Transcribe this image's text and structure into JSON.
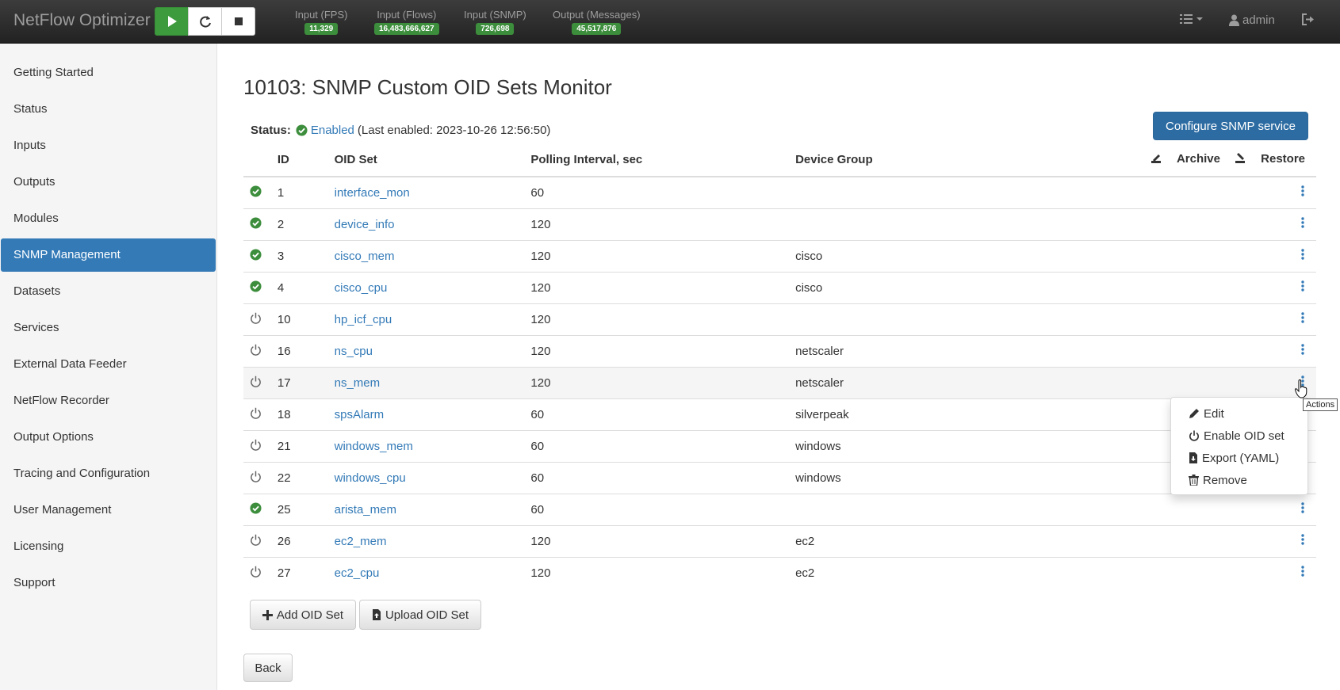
{
  "navbar": {
    "brand": "NetFlow Optimizer",
    "controls": {
      "play": "play-icon",
      "reload": "refresh-icon",
      "stop": "stop-icon"
    },
    "metrics": [
      {
        "label": "Input (FPS)",
        "value": "11,329"
      },
      {
        "label": "Input (Flows)",
        "value": "16,483,666,627"
      },
      {
        "label": "Input (SNMP)",
        "value": "726,698"
      },
      {
        "label": "Output (Messages)",
        "value": "45,517,876"
      }
    ],
    "user": "admin"
  },
  "sidebar": {
    "items": [
      {
        "label": "Getting Started"
      },
      {
        "label": "Status"
      },
      {
        "label": "Inputs"
      },
      {
        "label": "Outputs"
      },
      {
        "label": "Modules"
      },
      {
        "label": "SNMP Management",
        "active": true
      },
      {
        "label": "Datasets"
      },
      {
        "label": "Services"
      },
      {
        "label": "External Data Feeder"
      },
      {
        "label": "NetFlow Recorder"
      },
      {
        "label": "Output Options"
      },
      {
        "label": "Tracing and Configuration"
      },
      {
        "label": "User Management"
      },
      {
        "label": "Licensing"
      },
      {
        "label": "Support"
      }
    ]
  },
  "main": {
    "title": "10103: SNMP Custom OID Sets Monitor",
    "status": {
      "label": "Status:",
      "value": "Enabled",
      "detail": "(Last enabled: 2023-10-26 12:56:50)"
    },
    "configure_button": "Configure SNMP service",
    "table": {
      "headers": {
        "id": "ID",
        "oid_set": "OID Set",
        "interval": "Polling Interval, sec",
        "group": "Device Group",
        "archive": "Archive",
        "restore": "Restore"
      },
      "rows": [
        {
          "enabled": true,
          "id": "1",
          "name": "interface_mon",
          "interval": "60",
          "group": ""
        },
        {
          "enabled": true,
          "id": "2",
          "name": "device_info",
          "interval": "120",
          "group": ""
        },
        {
          "enabled": true,
          "id": "3",
          "name": "cisco_mem",
          "interval": "120",
          "group": "cisco"
        },
        {
          "enabled": true,
          "id": "4",
          "name": "cisco_cpu",
          "interval": "120",
          "group": "cisco"
        },
        {
          "enabled": false,
          "id": "10",
          "name": "hp_icf_cpu",
          "interval": "120",
          "group": ""
        },
        {
          "enabled": false,
          "id": "16",
          "name": "ns_cpu",
          "interval": "120",
          "group": "netscaler"
        },
        {
          "enabled": false,
          "id": "17",
          "name": "ns_mem",
          "interval": "120",
          "group": "netscaler"
        },
        {
          "enabled": false,
          "id": "18",
          "name": "spsAlarm",
          "interval": "60",
          "group": "silverpeak"
        },
        {
          "enabled": false,
          "id": "21",
          "name": "windows_mem",
          "interval": "60",
          "group": "windows"
        },
        {
          "enabled": false,
          "id": "22",
          "name": "windows_cpu",
          "interval": "60",
          "group": "windows"
        },
        {
          "enabled": true,
          "id": "25",
          "name": "arista_mem",
          "interval": "60",
          "group": ""
        },
        {
          "enabled": false,
          "id": "26",
          "name": "ec2_mem",
          "interval": "120",
          "group": "ec2"
        },
        {
          "enabled": false,
          "id": "27",
          "name": "ec2_cpu",
          "interval": "120",
          "group": "ec2"
        }
      ]
    },
    "add_button": "Add OID Set",
    "upload_button": "Upload OID Set",
    "back_button": "Back"
  },
  "actions_menu": {
    "tooltip": "Actions",
    "items": [
      {
        "label": "Edit",
        "icon": "pencil-icon"
      },
      {
        "label": "Enable OID set",
        "icon": "power-icon"
      },
      {
        "label": "Export (YAML)",
        "icon": "export-icon"
      },
      {
        "label": "Remove",
        "icon": "trash-icon"
      }
    ]
  },
  "colors": {
    "navbar": "#222222",
    "primary": "#337ab7",
    "enabled": "#3c8d3c",
    "play": "#3d9a3d"
  }
}
